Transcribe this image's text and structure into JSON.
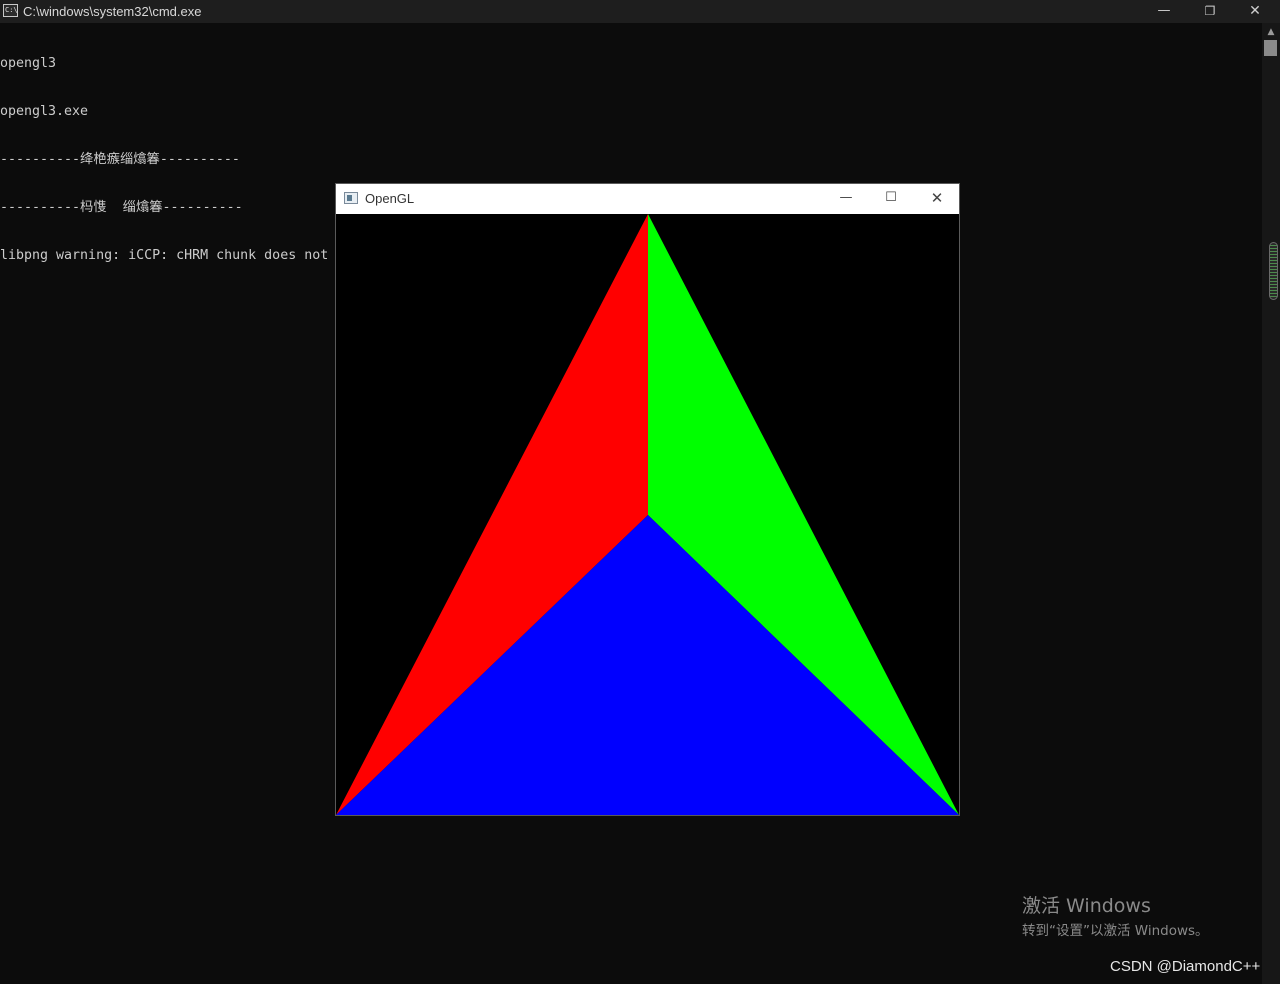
{
  "cmd_window": {
    "icon_text": "C:\\",
    "title": "C:\\windows\\system32\\cmd.exe",
    "minimize_glyph": "—",
    "restore_glyph": "❐",
    "close_glyph": "✕",
    "console_lines": [
      "opengl3",
      "opengl3.exe",
      "----------绛栬瘯缁熻箺----------",
      "----------杩愯  缁熻箺----------",
      "libpng warning: iCCP: cHRM chunk does not match sRGB"
    ],
    "scroll_up_glyph": "▲"
  },
  "gl_window": {
    "title": "OpenGL",
    "minimize_glyph": "—",
    "maximize_glyph": "☐",
    "close_glyph": "✕",
    "clear_color": "#000000",
    "triangles": [
      {
        "name": "red-triangle",
        "color": "#ff0000"
      },
      {
        "name": "green-triangle",
        "color": "#00ff00"
      },
      {
        "name": "blue-triangle",
        "color": "#0000ff"
      }
    ]
  },
  "watermark": {
    "activate_title": "激活 Windows",
    "activate_sub": "转到“设置”以激活 Windows。",
    "csdn": "CSDN @DiamondC++"
  }
}
